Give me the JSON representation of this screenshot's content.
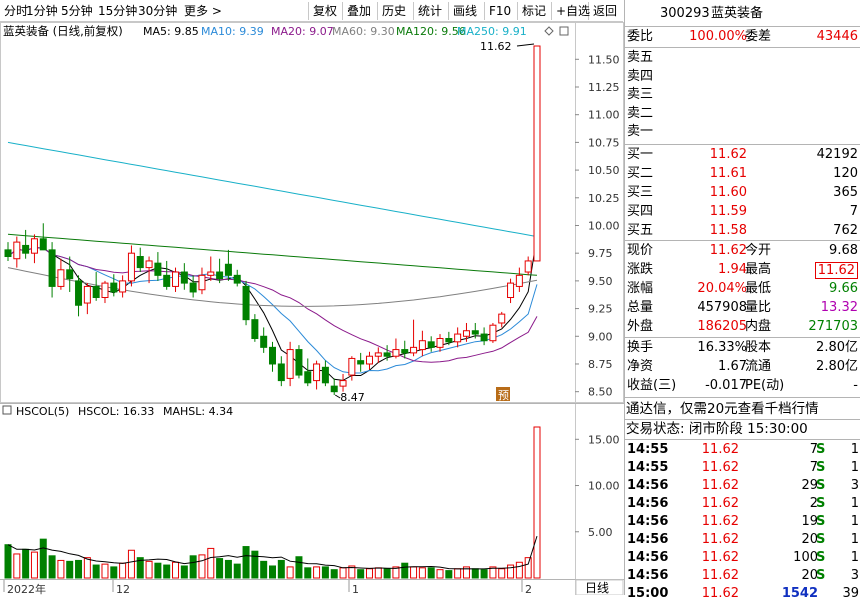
{
  "toolbar": {
    "left": [
      {
        "label": "分时"
      },
      {
        "label": "1分钟"
      },
      {
        "label": "5分钟"
      },
      {
        "label": "15分钟"
      },
      {
        "label": "30分钟"
      },
      {
        "label": "更多 >"
      }
    ],
    "right": [
      {
        "label": "复权"
      },
      {
        "label": "叠加"
      },
      {
        "label": "历史"
      },
      {
        "label": "统计"
      },
      {
        "label": "画线"
      },
      {
        "label": "F10"
      },
      {
        "label": "标记"
      },
      {
        "label": "+自选"
      },
      {
        "label": "返回"
      }
    ]
  },
  "chart_header": {
    "title": "蓝英装备 (日线,前复权)",
    "ma": [
      {
        "label": "MA5: 9.85",
        "color": "#000000"
      },
      {
        "label": "MA10: 9.39",
        "color": "#2b8ad8"
      },
      {
        "label": "MA20: 9.07",
        "color": "#8b1a8b"
      },
      {
        "label": "MA60: 9.30",
        "color": "#808080"
      },
      {
        "label": "MA120: 9.56",
        "color": "#0a7a0a"
      },
      {
        "label": "MA250: 9.91",
        "color": "#18b0c8"
      }
    ]
  },
  "vol_header": {
    "label": "HSCOL(5)",
    "items": [
      {
        "label": "HSCOL: 16.33",
        "color": "#000000"
      },
      {
        "label": "MAHSL: 4.34",
        "color": "#000000"
      }
    ]
  },
  "price_axis": [
    "11.50",
    "11.25",
    "11.00",
    "10.75",
    "10.50",
    "10.25",
    "10.00",
    "9.75",
    "9.50",
    "9.25",
    "9.00",
    "8.75",
    "8.50"
  ],
  "vol_axis": [
    "15.00",
    "10.00",
    "5.00"
  ],
  "x_labels": [
    "2022年",
    "12",
    "1",
    "2"
  ],
  "period_button": "日线",
  "annotations": {
    "high": "11.62",
    "low": "8.47",
    "marker": "预"
  },
  "colors": {
    "up": "#e60000",
    "down": "#008000",
    "bg": "#ffffff"
  },
  "chart_data": {
    "type": "candlestick",
    "title": "蓝英装备 (日线,前复权)",
    "ylim": [
      8.4,
      11.65
    ],
    "ohlc": [
      [
        9.78,
        9.85,
        9.68,
        9.72
      ],
      [
        9.7,
        9.9,
        9.62,
        9.85
      ],
      [
        9.82,
        9.96,
        9.7,
        9.75
      ],
      [
        9.75,
        9.92,
        9.66,
        9.88
      ],
      [
        9.88,
        10.02,
        9.8,
        9.78
      ],
      [
        9.78,
        9.85,
        9.35,
        9.45
      ],
      [
        9.45,
        9.7,
        9.42,
        9.6
      ],
      [
        9.6,
        9.72,
        9.4,
        9.52
      ],
      [
        9.5,
        9.55,
        9.18,
        9.28
      ],
      [
        9.3,
        9.48,
        9.2,
        9.45
      ],
      [
        9.45,
        9.58,
        9.32,
        9.35
      ],
      [
        9.35,
        9.5,
        9.3,
        9.48
      ],
      [
        9.48,
        9.56,
        9.36,
        9.4
      ],
      [
        9.4,
        9.55,
        9.35,
        9.5
      ],
      [
        9.5,
        9.82,
        9.45,
        9.75
      ],
      [
        9.72,
        9.8,
        9.58,
        9.62
      ],
      [
        9.62,
        9.72,
        9.48,
        9.68
      ],
      [
        9.66,
        9.76,
        9.5,
        9.55
      ],
      [
        9.55,
        9.68,
        9.42,
        9.45
      ],
      [
        9.45,
        9.62,
        9.4,
        9.58
      ],
      [
        9.58,
        9.66,
        9.42,
        9.48
      ],
      [
        9.48,
        9.55,
        9.35,
        9.4
      ],
      [
        9.42,
        9.62,
        9.38,
        9.55
      ],
      [
        9.55,
        9.72,
        9.5,
        9.58
      ],
      [
        9.58,
        9.7,
        9.48,
        9.52
      ],
      [
        9.65,
        9.78,
        9.5,
        9.55
      ],
      [
        9.55,
        9.6,
        9.45,
        9.48
      ],
      [
        9.45,
        9.5,
        9.1,
        9.15
      ],
      [
        9.15,
        9.2,
        8.95,
        8.98
      ],
      [
        9.0,
        9.08,
        8.85,
        8.9
      ],
      [
        8.9,
        8.95,
        8.68,
        8.75
      ],
      [
        8.75,
        8.82,
        8.55,
        8.6
      ],
      [
        8.62,
        8.95,
        8.55,
        8.88
      ],
      [
        8.88,
        8.92,
        8.62,
        8.65
      ],
      [
        8.68,
        8.8,
        8.55,
        8.58
      ],
      [
        8.6,
        8.78,
        8.52,
        8.75
      ],
      [
        8.72,
        8.78,
        8.55,
        8.58
      ],
      [
        8.55,
        8.62,
        8.47,
        8.5
      ],
      [
        8.55,
        8.66,
        8.5,
        8.6
      ],
      [
        8.65,
        8.82,
        8.6,
        8.8
      ],
      [
        8.78,
        8.85,
        8.68,
        8.75
      ],
      [
        8.75,
        8.86,
        8.7,
        8.82
      ],
      [
        8.82,
        8.9,
        8.76,
        8.85
      ],
      [
        8.85,
        8.92,
        8.78,
        8.82
      ],
      [
        8.82,
        8.98,
        8.8,
        8.88
      ],
      [
        8.88,
        8.96,
        8.8,
        8.85
      ],
      [
        8.85,
        9.15,
        8.82,
        8.9
      ],
      [
        8.88,
        9.05,
        8.82,
        8.96
      ],
      [
        8.95,
        9.0,
        8.86,
        8.9
      ],
      [
        8.9,
        9.02,
        8.86,
        8.98
      ],
      [
        8.98,
        9.04,
        8.92,
        8.95
      ],
      [
        8.95,
        9.08,
        8.9,
        9.02
      ],
      [
        9.0,
        9.12,
        8.95,
        9.05
      ],
      [
        9.05,
        9.12,
        8.98,
        9.02
      ],
      [
        9.02,
        9.08,
        8.92,
        8.96
      ],
      [
        8.96,
        9.12,
        8.94,
        9.1
      ],
      [
        9.12,
        9.22,
        9.08,
        9.2
      ],
      [
        9.35,
        9.52,
        9.3,
        9.48
      ],
      [
        9.45,
        9.62,
        9.4,
        9.55
      ],
      [
        9.58,
        9.72,
        9.55,
        9.68
      ],
      [
        9.68,
        11.62,
        9.68,
        11.62
      ]
    ],
    "hscol": [
      3.6,
      2.6,
      3.1,
      2.8,
      4.2,
      2.4,
      1.9,
      1.8,
      1.9,
      2.2,
      1.4,
      1.5,
      1.2,
      1.6,
      3.0,
      2.2,
      1.8,
      1.6,
      1.4,
      1.7,
      1.3,
      2.4,
      2.5,
      3.2,
      2.1,
      1.9,
      1.5,
      3.4,
      2.9,
      1.8,
      1.3,
      1.9,
      1.2,
      2.3,
      1.1,
      1.2,
      1.2,
      0.9,
      1.1,
      1.3,
      0.9,
      1.0,
      1.1,
      1.0,
      1.2,
      1.6,
      1.2,
      1.1,
      1.1,
      0.9,
      0.8,
      1.0,
      1.2,
      1.0,
      0.9,
      1.2,
      1.0,
      1.4,
      1.7,
      2.2,
      16.33
    ],
    "mahsl_last": 4.34
  },
  "quote": {
    "code": "300293",
    "name": "蓝英装备",
    "weibi_label": "委比",
    "weibi": "100.00%",
    "weicha_label": "委差",
    "weicha": "43446",
    "sell": [
      {
        "label": "卖五"
      },
      {
        "label": "卖四"
      },
      {
        "label": "卖三"
      },
      {
        "label": "卖二"
      },
      {
        "label": "卖一"
      }
    ],
    "buy": [
      {
        "label": "买一",
        "price": "11.62",
        "vol": "42192"
      },
      {
        "label": "买二",
        "price": "11.61",
        "vol": "120"
      },
      {
        "label": "买三",
        "price": "11.60",
        "vol": "365"
      },
      {
        "label": "买四",
        "price": "11.59",
        "vol": "7"
      },
      {
        "label": "买五",
        "price": "11.58",
        "vol": "762"
      }
    ],
    "stats": [
      {
        "l1": "现价",
        "v1": "11.62",
        "c1": "red",
        "l2": "今开",
        "v2": "9.68",
        "c2": "blk"
      },
      {
        "l1": "涨跌",
        "v1": "1.94",
        "c1": "red",
        "l2": "最高",
        "v2": "11.62",
        "c2": "red"
      },
      {
        "l1": "涨幅",
        "v1": "20.04%",
        "c1": "red",
        "l2": "最低",
        "v2": "9.66",
        "c2": "green"
      },
      {
        "l1": "总量",
        "v1": "457908",
        "c1": "blk",
        "l2": "量比",
        "v2": "13.32",
        "c2": "purple"
      },
      {
        "l1": "外盘",
        "v1": "186205",
        "c1": "red",
        "l2": "内盘",
        "v2": "271703",
        "c2": "green"
      }
    ],
    "stats2": [
      {
        "l1": "换手",
        "v1": "16.33%",
        "l2": "股本",
        "v2": "2.80亿"
      },
      {
        "l1": "净资",
        "v1": "1.67",
        "l2": "流通",
        "v2": "2.80亿"
      },
      {
        "l1": "收益(三)",
        "v1": "-0.017",
        "l2": "PE(动)",
        "v2": "-"
      }
    ],
    "banner": "通达信，仅需20元查看千档行情",
    "status": "交易状态: 闭市阶段 15:30:00",
    "ticks": [
      {
        "t": "14:55",
        "p": "11.62",
        "v": "7",
        "s": "S",
        "n": "1"
      },
      {
        "t": "14:55",
        "p": "11.62",
        "v": "7",
        "s": "S",
        "n": "1"
      },
      {
        "t": "14:56",
        "p": "11.62",
        "v": "29",
        "s": "S",
        "n": "3"
      },
      {
        "t": "14:56",
        "p": "11.62",
        "v": "2",
        "s": "S",
        "n": "1"
      },
      {
        "t": "14:56",
        "p": "11.62",
        "v": "19",
        "s": "S",
        "n": "1"
      },
      {
        "t": "14:56",
        "p": "11.62",
        "v": "20",
        "s": "S",
        "n": "1"
      },
      {
        "t": "14:56",
        "p": "11.62",
        "v": "100",
        "s": "S",
        "n": "1"
      },
      {
        "t": "14:56",
        "p": "11.62",
        "v": "20",
        "s": "S",
        "n": "3"
      },
      {
        "t": "15:00",
        "p": "11.62",
        "v": "1542",
        "s": "",
        "n": "39"
      }
    ]
  }
}
